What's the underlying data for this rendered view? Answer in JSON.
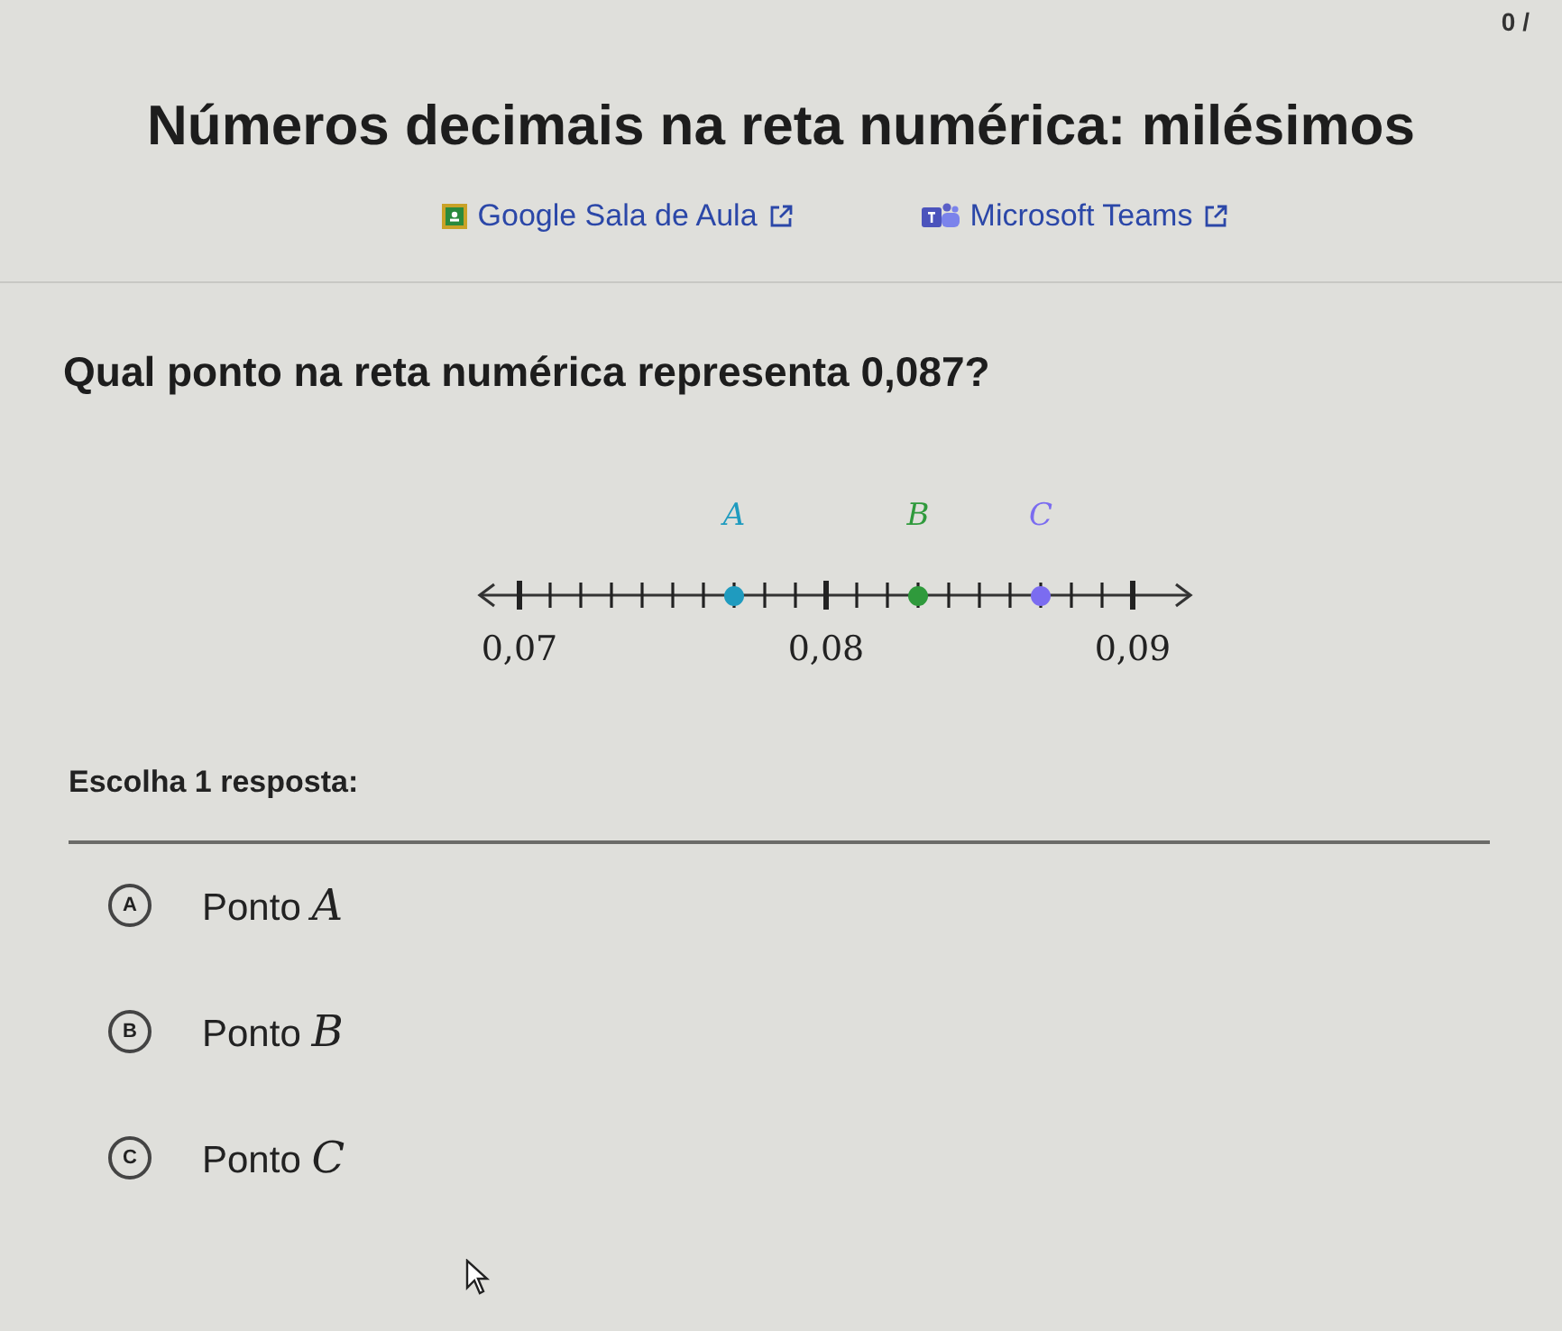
{
  "progress": "0 /",
  "title": "Números decimais na reta numérica: milésimos",
  "links": [
    {
      "kind": "classroom",
      "label": "Google Sala de Aula"
    },
    {
      "kind": "teams",
      "label": "Microsoft Teams"
    }
  ],
  "question": "Qual ponto na reta numérica representa 0,087?",
  "number_line": {
    "labels": [
      "0,07",
      "0,08",
      "0,09"
    ],
    "points": [
      {
        "label": "A",
        "color": "#1f9bbf"
      },
      {
        "label": "B",
        "color": "#2f9a3c"
      },
      {
        "label": "C",
        "color": "#7b6cf0"
      }
    ]
  },
  "prompt": "Escolha 1 resposta:",
  "choices": [
    {
      "letter": "A",
      "text": "Ponto",
      "variable": "A",
      "selected": false
    },
    {
      "letter": "B",
      "text": "Ponto",
      "variable": "B",
      "selected": false
    },
    {
      "letter": "C",
      "text": "Ponto",
      "variable": "C",
      "selected": false
    }
  ]
}
